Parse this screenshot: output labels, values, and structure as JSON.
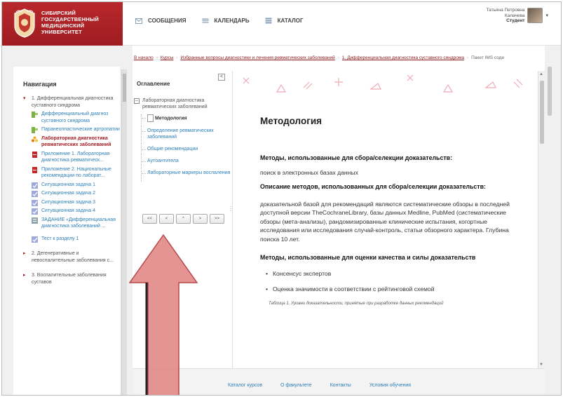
{
  "brand": {
    "lines": [
      "СИБИРСКИЙ",
      "ГОСУДАРСТВЕННЫЙ",
      "МЕДИЦИНСКИЙ",
      "УНИВЕРСИТЕТ"
    ],
    "color": "#a3202a"
  },
  "topnav": [
    {
      "label": "СООБЩЕНИЯ",
      "icon": "envelope-icon"
    },
    {
      "label": "КАЛЕНДАРЬ",
      "icon": "calendar-icon"
    },
    {
      "label": "КАТАЛОГ",
      "icon": "catalog-icon"
    }
  ],
  "user": {
    "first": "Татьяна Петровна",
    "last": "Калачева",
    "role": "Студент"
  },
  "breadcrumb": {
    "items": [
      "В начало",
      "Курсы",
      "Избранные вопросы диагностики и лечения ревматических заболеваний",
      "1. Дифференциальная диагностика суставного синдрома"
    ],
    "current": "Пакет IMS соде"
  },
  "nav": {
    "title": "Навигация",
    "sections": [
      {
        "label": "1. Дифференциальная диагностика суставного синдрома",
        "items": [
          {
            "label": "Дифференциальный диагноз суставного синдрома",
            "icon": "page-icon",
            "active": false
          },
          {
            "label": "Паранеопластические артропатии",
            "icon": "page-icon",
            "active": false
          },
          {
            "label": "Лабораторная диагностика ревматических заболеваний",
            "icon": "package-icon",
            "active": true
          },
          {
            "label": "Приложение 1. Лабораторная диагностика ревматическ...",
            "icon": "file-icon",
            "active": false
          },
          {
            "label": "Приложение 2. Национальные рекомендации по лаборат...",
            "icon": "file-icon",
            "active": false
          },
          {
            "label": "Ситуационная задача 1",
            "icon": "quiz-icon",
            "active": false
          },
          {
            "label": "Ситуационная задача 2",
            "icon": "quiz-icon",
            "active": false
          },
          {
            "label": "Ситуационная задача 3",
            "icon": "quiz-icon",
            "active": false
          },
          {
            "label": "Ситуационная задача 4",
            "icon": "quiz-icon",
            "active": false
          },
          {
            "label": "ЗАДАНИЕ «Дифференциальная диагностика заболеваний ...",
            "icon": "assignment-icon",
            "active": false
          },
          {
            "label": "Тест к разделу 1",
            "icon": "quiz-icon",
            "active": false
          }
        ]
      },
      {
        "label": "2. Дегенеративные и невоспалительные заболевания с...",
        "items": []
      },
      {
        "label": "3. Воспалительные заболевания суставов",
        "items": []
      }
    ]
  },
  "toc": {
    "title": "Оглавление",
    "collapse_label": "<",
    "root": "Лабораторная диагностика ревматических заболеваний",
    "items": [
      {
        "label": "Методология",
        "current": true
      },
      {
        "label": "Определение ревматических заболеваний",
        "current": false
      },
      {
        "label": "Общие рекомендации",
        "current": false
      },
      {
        "label": "Аутоантитела",
        "current": false
      },
      {
        "label": "Лабораторные маркеры воспаления",
        "current": false
      }
    ],
    "buttons": [
      "<<",
      "<",
      "^",
      ">",
      ">>"
    ]
  },
  "content": {
    "title": "Методология",
    "h1": "Методы, использованные для сбора/селекции доказательств:",
    "p1": "поиск в электронных базах данных",
    "h2": "Описание методов, использованных для сбора/селекции доказательств:",
    "p2": "доказательной базой для рекомендаций являются систематические обзоры в последней доступной версии TheCochraneLibrary, базы данных Medline, PubMed (систематические обзоры (мета-анализы), рандомизированные клинические испытания, когортные исследования или исследования случай-контроль, статьи обзорного характера. Глубина поиска 10 лет.",
    "h3": "Методы, использованные для оценки качества и силы доказательств",
    "bullets": [
      "Консенсус экспертов",
      "Оценка значимости в соответствии с рейтинговой схемой"
    ],
    "caption": "Таблица 1. Уровни доказательности, принятые при разработке данных рекомендаций"
  },
  "footer": {
    "links": [
      "Каталог курсов",
      "О факультете",
      "Контакты",
      "Условия обучения"
    ]
  },
  "overlay": {
    "arrow_color": "#e38b8b",
    "arrow_direction": "up"
  }
}
